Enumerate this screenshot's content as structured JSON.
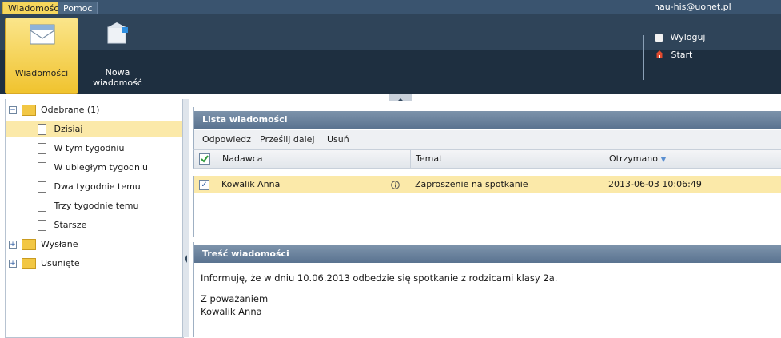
{
  "menu_tabs": [
    "Wiadomości",
    "Pomoc"
  ],
  "user_email": "nau-his@uonet.pl",
  "ribbon": {
    "buttons": [
      {
        "label": "Wiadomości"
      },
      {
        "label_line1": "Nowa",
        "label_line2": "wiadomość"
      }
    ],
    "links": [
      "Wyloguj",
      "Start"
    ]
  },
  "tree": {
    "received": "Odebrane (1)",
    "children": [
      "Dzisiaj",
      "W tym tygodniu",
      "W ubiegłym tygodniu",
      "Dwa tygodnie temu",
      "Trzy tygodnie temu",
      "Starsze"
    ],
    "sent": "Wysłane",
    "deleted": "Usunięte"
  },
  "list_panel": {
    "title": "Lista wiadomości",
    "toolbar": [
      "Odpowiedz",
      "Prześlij dalej",
      "Usuń"
    ],
    "columns": [
      "Nadawca",
      "Temat",
      "Otrzymano"
    ],
    "rows": [
      {
        "sender": "Kowalik Anna",
        "subject": "Zaproszenie na spotkanie",
        "received": "2013-06-03 10:06:49"
      }
    ]
  },
  "content_panel": {
    "title": "Treść wiadomości",
    "body_line1": "Informuję, że w dniu 10.06.2013 odbedzie się spotkanie z rodzicami klasy 2a.",
    "body_line2": "Z poważaniem",
    "body_line3": "Kowalik Anna"
  },
  "colors": {
    "accent_yellow": "#f6d65c",
    "header_dark": "#2f4459",
    "panel_header": "#6a829c",
    "selection": "#fbe9a9"
  },
  "icons": [
    "envelope-icon",
    "new-message-icon",
    "lock-icon",
    "home-icon",
    "folder-icon",
    "document-icon",
    "info-icon",
    "checkbox-icon",
    "sort-desc-icon"
  ]
}
